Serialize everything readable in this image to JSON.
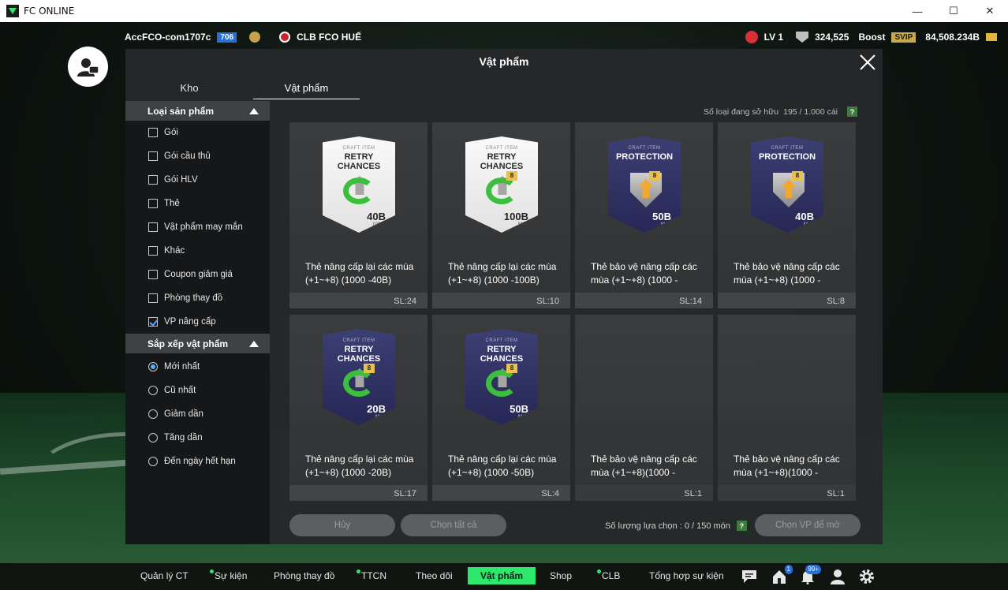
{
  "window": {
    "title": "FC ONLINE",
    "controls": [
      "—",
      "☐",
      "✕"
    ]
  },
  "hud": {
    "username": "AccFCO-com1707c",
    "level_badge": "706",
    "club_name": "CLB FCO HUẾ",
    "lv": "LV 1",
    "score": "324,525",
    "boost_label": "Boost",
    "svip": "SVIP",
    "balance": "84,508.234B"
  },
  "modal": {
    "title": "Vật phẩm",
    "tabs": [
      {
        "label": "Kho"
      },
      {
        "label": "Vật phẩm"
      }
    ],
    "owned_label": "Số loại đang sở hữu",
    "owned_value": "195 / 1.000 cái",
    "help": "?"
  },
  "sidebar": {
    "product_type_header": "Loại sản phẩm",
    "product_types": [
      {
        "label": "Gói",
        "checked": false
      },
      {
        "label": "Gói cầu thủ",
        "checked": false
      },
      {
        "label": "Gói HLV",
        "checked": false
      },
      {
        "label": "Thẻ",
        "checked": false
      },
      {
        "label": "Vật phẩm may mắn",
        "checked": false
      },
      {
        "label": "Khác",
        "checked": false
      },
      {
        "label": "Coupon giảm giá",
        "checked": false
      },
      {
        "label": "Phòng thay đồ",
        "checked": false
      },
      {
        "label": "VP nâng cấp",
        "checked": true
      }
    ],
    "sort_header": "Sắp xếp vật phẩm",
    "sort_options": [
      {
        "label": "Mới nhất",
        "selected": true
      },
      {
        "label": "Cũ nhất",
        "selected": false
      },
      {
        "label": "Giảm dần",
        "selected": false
      },
      {
        "label": "Tăng dần",
        "selected": false
      },
      {
        "label": "Đến ngày hết hạn",
        "selected": false
      }
    ]
  },
  "items": [
    {
      "name": "Thẻ nâng cấp lại các mùa (+1~+8) (1000 -40B)",
      "qty": "SL:24",
      "style": "white",
      "kind": "retry",
      "card_small": "CRAFT ITEM",
      "card_title": "RETRY CHANCES",
      "value": "40B",
      "value_sub": "1000~",
      "lvl": ""
    },
    {
      "name": "Thẻ nâng cấp lại các mùa (+1~+8) (1000 -100B)",
      "qty": "SL:10",
      "style": "white",
      "kind": "retry",
      "card_small": "CRAFT ITEM",
      "card_title": "RETRY CHANCES",
      "value": "100B",
      "value_sub": "MAX",
      "lvl": "8"
    },
    {
      "name": "Thẻ bảo vệ nâng cấp các mùa (+1~+8) (1000 -",
      "qty": "SL:14",
      "style": "dark",
      "kind": "protection",
      "card_small": "CRAFT ITEM",
      "card_title": "PROTECTION",
      "value": "50B",
      "value_sub": "MAX",
      "lvl": "8"
    },
    {
      "name": "Thẻ bảo vệ nâng cấp các mùa (+1~+8) (1000 -",
      "qty": "SL:8",
      "style": "dark",
      "kind": "protection",
      "card_small": "CRAFT ITEM",
      "card_title": "PROTECTION",
      "value": "40B",
      "value_sub": "MAX",
      "lvl": "8"
    },
    {
      "name": "Thẻ nâng cấp lại các mùa (+1~+8) (1000 -20B)",
      "qty": "SL:17",
      "style": "dark",
      "kind": "retry",
      "card_small": "CRAFT ITEM",
      "card_title": "RETRY CHANCES",
      "value": "20B",
      "value_sub": "MAX",
      "lvl": "8"
    },
    {
      "name": "Thẻ nâng cấp lại các mùa (+1~+8) (1000 -50B)",
      "qty": "SL:4",
      "style": "dark",
      "kind": "retry",
      "card_small": "CRAFT ITEM",
      "card_title": "RETRY CHANCES",
      "value": "50B",
      "value_sub": "MAX",
      "lvl": "8"
    },
    {
      "name": "Thẻ bảo vệ nâng cấp các mùa (+1~+8)(1000 -",
      "qty": "SL:1",
      "style": "none",
      "kind": "",
      "card_small": "",
      "card_title": "",
      "value": "",
      "value_sub": "",
      "lvl": ""
    },
    {
      "name": "Thẻ bảo vệ nâng cấp các mùa (+1~+8)(1000 -",
      "qty": "SL:1",
      "style": "none",
      "kind": "",
      "card_small": "",
      "card_title": "",
      "value": "",
      "value_sub": "",
      "lvl": ""
    }
  ],
  "footer": {
    "cancel_label": "Hủy",
    "select_all_label": "Chọn tất cả",
    "selected_count_label": "Số lượng lựa chọn : 0 / 150 món",
    "help": "?",
    "open_label": "Chọn VP để mở"
  },
  "bottom_nav": {
    "items": [
      {
        "label": "Quản lý CT",
        "dot": false
      },
      {
        "label": "Sự kiện",
        "dot": true
      },
      {
        "label": "Phòng thay đồ",
        "dot": false
      },
      {
        "label": "TTCN",
        "dot": true
      },
      {
        "label": "Theo dõi",
        "dot": false
      },
      {
        "label": "Vật phẩm",
        "dot": false,
        "active": true
      },
      {
        "label": "Shop",
        "dot": false
      },
      {
        "label": "CLB",
        "dot": true
      },
      {
        "label": "Tổng hợp sự kiện",
        "dot": false
      }
    ],
    "home_badge": "1",
    "bell_badge": "99+"
  },
  "colors": {
    "accent": "#2ee86e",
    "check": "#58a9ff",
    "panel": "#26282a"
  }
}
